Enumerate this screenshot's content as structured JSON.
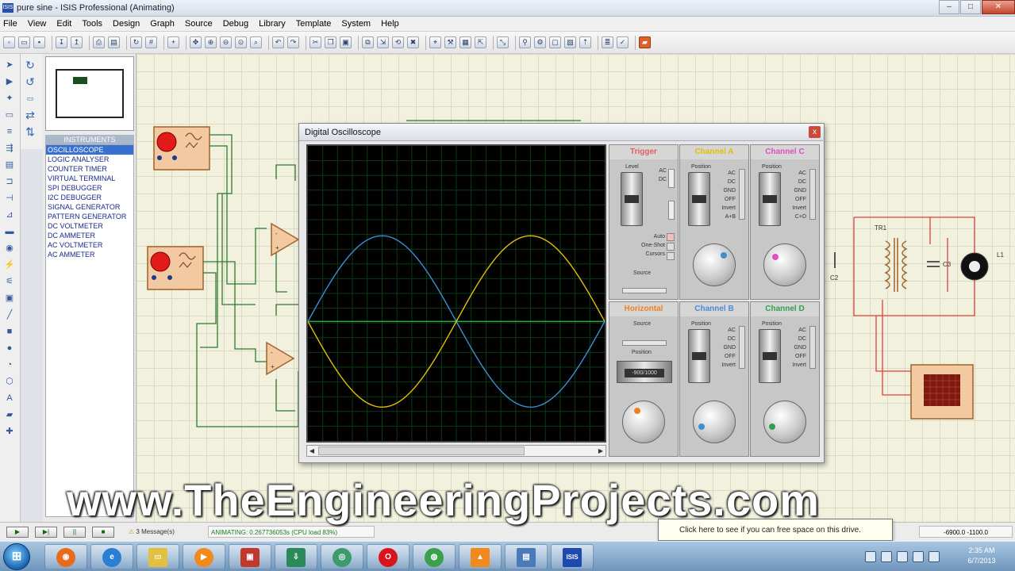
{
  "window": {
    "title": "pure sine - ISIS Professional (Animating)",
    "app_icon": "ISIS"
  },
  "menu": [
    "File",
    "View",
    "Edit",
    "Tools",
    "Design",
    "Graph",
    "Source",
    "Debug",
    "Library",
    "Template",
    "System",
    "Help"
  ],
  "instruments": {
    "header": "INSTRUMENTS",
    "items": [
      "OSCILLOSCOPE",
      "LOGIC ANALYSER",
      "COUNTER TIMER",
      "VIRTUAL TERMINAL",
      "SPI DEBUGGER",
      "I2C DEBUGGER",
      "SIGNAL GENERATOR",
      "PATTERN GENERATOR",
      "DC VOLTMETER",
      "DC AMMETER",
      "AC VOLTMETER",
      "AC AMMETER"
    ],
    "selected_index": 0
  },
  "oscilloscope": {
    "title": "Digital Oscilloscope",
    "close_label": "x",
    "panels": {
      "trigger": "Trigger",
      "channel_a": "Channel A",
      "channel_b": "Channel B",
      "channel_c": "Channel C",
      "channel_d": "Channel D",
      "horizontal": "Horizontal"
    },
    "trigger": {
      "level_label": "Level",
      "coupling_ac": "AC",
      "coupling_dc": "DC",
      "modes": [
        "Auto",
        "One-Shot",
        "Cursors"
      ],
      "source_label": "Source"
    },
    "channel_options": [
      "AC",
      "DC",
      "GND",
      "OFF",
      "Invert"
    ],
    "channel_a_extra": "A+B",
    "channel_c_extra": "C+D",
    "position_label": "Position",
    "horizontal": {
      "source_label": "Source",
      "position_label": "Position",
      "readout": "-900/1000"
    },
    "waveforms": {
      "colors": {
        "A": "#e0c000",
        "B": "#3a8fd0",
        "D": "#2fae4f"
      },
      "cycles_visible": 1
    }
  },
  "schematic": {
    "transformer_label": "TR1",
    "cap_c3": "C3",
    "cap_c2": "C2",
    "lamp": "L1"
  },
  "statusbar": {
    "play": "▶",
    "step": "▶|",
    "pause": "||",
    "stop": "■",
    "messages": "3 Message(s)",
    "animating": "ANIMATING: 0.267736053s (CPU load 83%)",
    "coords": "-6900.0   -1100.0"
  },
  "tooltip": {
    "text": "Click here to see if you can free space on this drive."
  },
  "watermark": "www.TheEngineeringProjects.com",
  "taskbar": {
    "clock_time": "2:35 AM",
    "clock_date": "6/7/2013",
    "isis_label": "ISIS"
  }
}
